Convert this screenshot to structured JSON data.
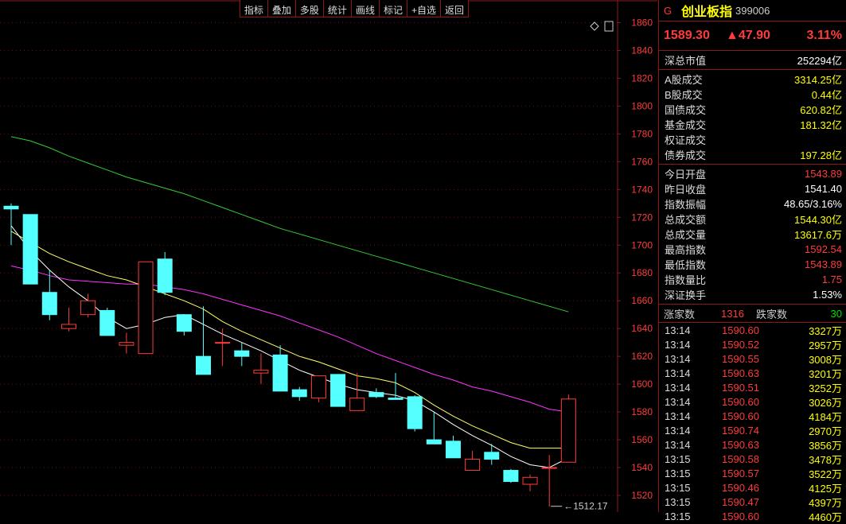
{
  "toolbar": {
    "items": [
      "指标",
      "叠加",
      "多股",
      "统计",
      "画线",
      "标记",
      "+自选",
      "返回"
    ]
  },
  "chart_data": {
    "type": "candlestick",
    "y_ticks": [
      1520,
      1540,
      1560,
      1580,
      1600,
      1620,
      1640,
      1660,
      1680,
      1700,
      1720,
      1740,
      1760,
      1780,
      1800,
      1820,
      1840,
      1860
    ],
    "ylim": [
      1508,
      1874
    ],
    "candles": [
      {
        "o": 1728,
        "c": 1726,
        "h": 1730,
        "l": 1700
      },
      {
        "o": 1722,
        "c": 1672,
        "h": 1722,
        "l": 1672
      },
      {
        "o": 1666,
        "c": 1650,
        "h": 1682,
        "l": 1646
      },
      {
        "o": 1640,
        "c": 1643,
        "h": 1655,
        "l": 1638
      },
      {
        "o": 1650,
        "c": 1660,
        "h": 1665,
        "l": 1648
      },
      {
        "o": 1653,
        "c": 1635,
        "h": 1655,
        "l": 1635
      },
      {
        "o": 1628,
        "c": 1630,
        "h": 1637,
        "l": 1622
      },
      {
        "o": 1622,
        "c": 1688,
        "h": 1688,
        "l": 1622
      },
      {
        "o": 1690,
        "c": 1666,
        "h": 1695,
        "l": 1664
      },
      {
        "o": 1650,
        "c": 1638,
        "h": 1650,
        "l": 1635
      },
      {
        "o": 1620,
        "c": 1607,
        "h": 1656,
        "l": 1607
      },
      {
        "o": 1630,
        "c": 1630,
        "h": 1640,
        "l": 1613
      },
      {
        "o": 1624,
        "c": 1620,
        "h": 1630,
        "l": 1613
      },
      {
        "o": 1608,
        "c": 1610,
        "h": 1622,
        "l": 1600
      },
      {
        "o": 1621,
        "c": 1595,
        "h": 1628,
        "l": 1595
      },
      {
        "o": 1596,
        "c": 1591,
        "h": 1598,
        "l": 1588
      },
      {
        "o": 1590,
        "c": 1606,
        "h": 1606,
        "l": 1587
      },
      {
        "o": 1607,
        "c": 1584,
        "h": 1607,
        "l": 1584
      },
      {
        "o": 1581,
        "c": 1590,
        "h": 1608,
        "l": 1581
      },
      {
        "o": 1594,
        "c": 1591,
        "h": 1597,
        "l": 1590
      },
      {
        "o": 1590,
        "c": 1589,
        "h": 1608,
        "l": 1589
      },
      {
        "o": 1591,
        "c": 1568,
        "h": 1592,
        "l": 1566
      },
      {
        "o": 1560,
        "c": 1557,
        "h": 1580,
        "l": 1557
      },
      {
        "o": 1559,
        "c": 1547,
        "h": 1563,
        "l": 1547
      },
      {
        "o": 1538,
        "c": 1546,
        "h": 1552,
        "l": 1538
      },
      {
        "o": 1551,
        "c": 1546,
        "h": 1557,
        "l": 1542
      },
      {
        "o": 1538,
        "c": 1530,
        "h": 1539,
        "l": 1529
      },
      {
        "o": 1528,
        "c": 1533,
        "h": 1535,
        "l": 1523
      },
      {
        "o": 1540,
        "c": 1540,
        "h": 1549,
        "l": 1512
      },
      {
        "o": 1543.89,
        "c": 1589.3,
        "h": 1592.54,
        "l": 1543.89
      }
    ],
    "ma_short": [
      1714,
      1696,
      1682,
      1670,
      1660,
      1648,
      1640,
      1643,
      1648,
      1650,
      1643,
      1636,
      1630,
      1624,
      1617,
      1610,
      1605,
      1600,
      1596,
      1594,
      1592,
      1588,
      1580,
      1571,
      1563,
      1556,
      1548,
      1542,
      1540,
      1547
    ],
    "ma_mid": [
      1710,
      1702,
      1694,
      1688,
      1683,
      1678,
      1675,
      1670,
      1665,
      1660,
      1654,
      1645,
      1638,
      1632,
      1626,
      1620,
      1616,
      1611,
      1606,
      1604,
      1601,
      1594,
      1585,
      1577,
      1570,
      1564,
      1558,
      1554,
      1554,
      1554
    ],
    "ma_long": [
      1685,
      1682,
      1678,
      1675,
      1674,
      1673,
      1672,
      1672,
      1670,
      1668,
      1665,
      1661,
      1657,
      1653,
      1649,
      1644,
      1639,
      1634,
      1628,
      1622,
      1617,
      1612,
      1607,
      1603,
      1598,
      1595,
      1591,
      1587,
      1582,
      1580
    ],
    "ma_slow": [
      1778,
      1775,
      1770,
      1764,
      1759,
      1754,
      1749,
      1745,
      1741,
      1737,
      1732,
      1727,
      1722,
      1717,
      1712,
      1708,
      1704,
      1700,
      1696,
      1692,
      1688,
      1684,
      1680,
      1676,
      1672,
      1668,
      1664,
      1660,
      1656,
      1652
    ],
    "low_marker": "1512.17",
    "colors": {
      "up": "#ff3b3b",
      "down": "#54ffff",
      "ma_short": "#ffffff",
      "ma_mid": "#ffff66",
      "ma_long": "#ff33ff",
      "ma_slow": "#33cc33",
      "grid": "#8a1a1a"
    }
  },
  "panel": {
    "flag": "G",
    "name": "创业板指",
    "code": "399006",
    "price": "1589.30",
    "change": "▲47.90",
    "pct": "3.11%",
    "market_value": {
      "label": "深总市值",
      "value": "252294亿"
    },
    "turnover": [
      {
        "label": "A股成交",
        "value": "3314.25亿"
      },
      {
        "label": "B股成交",
        "value": "0.44亿"
      },
      {
        "label": "国债成交",
        "value": "620.82亿"
      },
      {
        "label": "基金成交",
        "value": "181.32亿"
      },
      {
        "label": "权证成交",
        "value": ""
      },
      {
        "label": "债券成交",
        "value": "197.28亿"
      }
    ],
    "stats": [
      {
        "label": "今日开盘",
        "value": "1543.89",
        "color": "red"
      },
      {
        "label": "昨日收盘",
        "value": "1541.40",
        "color": "white"
      },
      {
        "label": "指数振幅",
        "value": "48.65/3.16%",
        "color": "white"
      },
      {
        "label": "总成交额",
        "value": "1544.30亿",
        "color": "yellow"
      },
      {
        "label": "总成交量",
        "value": "13617.6万",
        "color": "yellow"
      },
      {
        "label": "最高指数",
        "value": "1592.54",
        "color": "red"
      },
      {
        "label": "最低指数",
        "value": "1543.89",
        "color": "red"
      },
      {
        "label": "指数量比",
        "value": "1.75",
        "color": "red"
      },
      {
        "label": "深证换手",
        "value": "1.53%",
        "color": "white"
      }
    ],
    "rise_label": "涨家数",
    "rise_count": "1316",
    "fall_label": "跌家数",
    "fall_count": "30",
    "trades": [
      {
        "time": "13:14",
        "price": "1590.60",
        "vol": "3327万"
      },
      {
        "time": "13:14",
        "price": "1590.52",
        "vol": "2957万"
      },
      {
        "time": "13:14",
        "price": "1590.55",
        "vol": "3008万"
      },
      {
        "time": "13:14",
        "price": "1590.63",
        "vol": "3201万"
      },
      {
        "time": "13:14",
        "price": "1590.51",
        "vol": "3252万"
      },
      {
        "time": "13:14",
        "price": "1590.60",
        "vol": "3026万"
      },
      {
        "time": "13:14",
        "price": "1590.60",
        "vol": "4184万"
      },
      {
        "time": "13:14",
        "price": "1590.74",
        "vol": "2970万"
      },
      {
        "time": "13:14",
        "price": "1590.63",
        "vol": "3856万"
      },
      {
        "time": "13:15",
        "price": "1590.58",
        "vol": "3478万"
      },
      {
        "time": "13:15",
        "price": "1590.57",
        "vol": "3522万"
      },
      {
        "time": "13:15",
        "price": "1590.46",
        "vol": "4125万"
      },
      {
        "time": "13:15",
        "price": "1590.47",
        "vol": "4397万"
      },
      {
        "time": "13:15",
        "price": "1590.60",
        "vol": "4460万"
      }
    ]
  }
}
